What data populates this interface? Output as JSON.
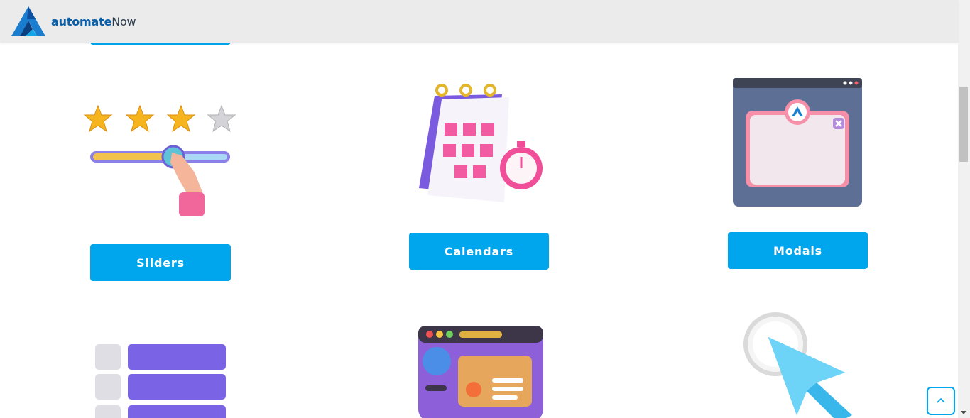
{
  "header": {
    "logo_text_a": "automate",
    "logo_text_b": "Now"
  },
  "cards": [
    {
      "label": "Sliders"
    },
    {
      "label": "Calendars"
    },
    {
      "label": "Modals"
    }
  ],
  "colors": {
    "accent": "#00a6ed",
    "header_bg": "#ebebeb"
  },
  "icons": [
    "automatenow-logo-icon",
    "star-rating-slider-icon",
    "calendar-stopwatch-icon",
    "modal-window-icon",
    "list-table-icon",
    "web-browser-icon",
    "cursor-click-icon",
    "chevron-up-icon"
  ]
}
